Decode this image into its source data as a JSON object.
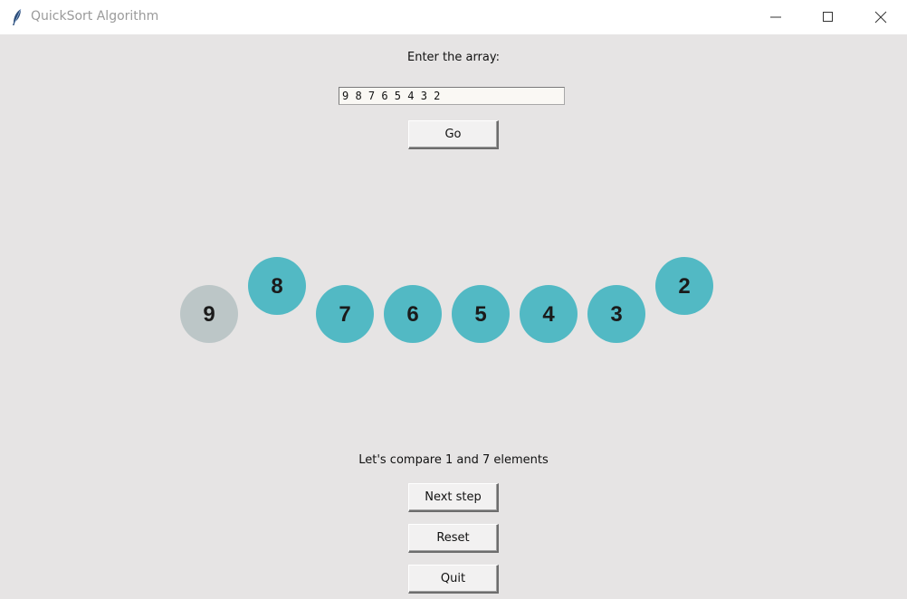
{
  "window": {
    "title": "QuickSort Algorithm",
    "icon": "feather-icon"
  },
  "prompt_label": "Enter the array:",
  "array_input": {
    "value": "9 8 7 6 5 4 3 2"
  },
  "buttons": {
    "go": "Go",
    "next_step": "Next step",
    "reset": "Reset",
    "quit": "Quit"
  },
  "status_text": "Let's compare 1 and 7 elements",
  "colors": {
    "active_circle": "#52b9c4",
    "pivot_circle": "#bcc6c7"
  },
  "circles": [
    {
      "value": "9",
      "state": "pivot",
      "raised": false
    },
    {
      "value": "8",
      "state": "active",
      "raised": true
    },
    {
      "value": "7",
      "state": "active",
      "raised": false
    },
    {
      "value": "6",
      "state": "active",
      "raised": false
    },
    {
      "value": "5",
      "state": "active",
      "raised": false
    },
    {
      "value": "4",
      "state": "active",
      "raised": false
    },
    {
      "value": "3",
      "state": "active",
      "raised": false
    },
    {
      "value": "2",
      "state": "active",
      "raised": true
    }
  ]
}
